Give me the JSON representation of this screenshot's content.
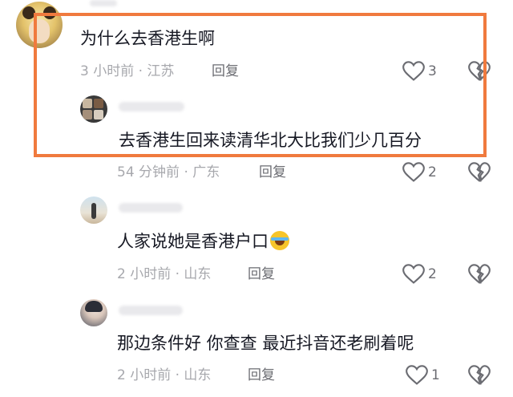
{
  "comments": [
    {
      "text": "为什么去香港生啊",
      "meta": "3 小时前 · 江苏",
      "reply_label": "回复",
      "likes": "3"
    },
    {
      "text": "去香港生回来读清华北大比我们少几百分",
      "meta": "54 分钟前 · 广东",
      "reply_label": "回复",
      "likes": "2"
    },
    {
      "text": "人家说她是香港户口",
      "meta": "2 小时前 · 山东",
      "reply_label": "回复",
      "likes": "2"
    },
    {
      "text": "那边条件好 你查查 最近抖音还老刷着呢",
      "meta": "2 小时前 · 山东",
      "reply_label": "回复",
      "likes": "1"
    }
  ],
  "icons": {
    "like": "heart-icon",
    "dislike": "broken-heart-icon",
    "emoji": "laughing-crying-emoji-icon"
  },
  "colors": {
    "highlight_border": "#f07a3e",
    "primary_text": "#161823",
    "meta_text": "#a7a8ad"
  }
}
